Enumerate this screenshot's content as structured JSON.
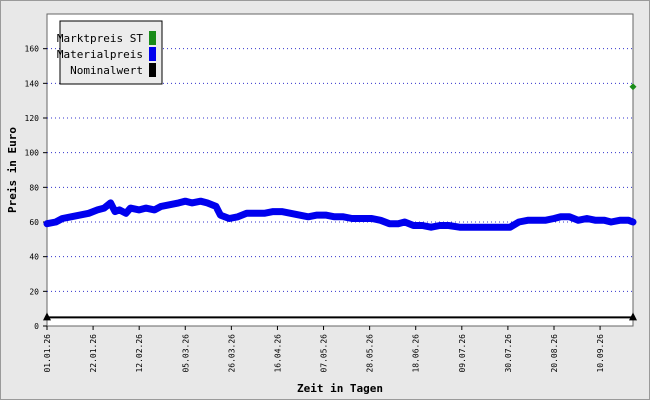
{
  "chart_data": {
    "type": "line",
    "xlabel": "Zeit in Tagen",
    "ylabel": "Preis in Euro",
    "ylim": [
      0,
      180
    ],
    "yticks": [
      0,
      20,
      40,
      60,
      80,
      100,
      120,
      140,
      160
    ],
    "xlim": [
      "2026-01-01",
      "2026-09-25"
    ],
    "xticks": [
      "01.01.26",
      "22.01.26",
      "12.02.26",
      "05.03.26",
      "26.03.26",
      "16.04.26",
      "07.05.26",
      "28.05.26",
      "18.06.26",
      "09.07.26",
      "30.07.26",
      "20.08.26",
      "10.09.26"
    ],
    "grid": "horizontal dotted",
    "legend_position": "top-left",
    "legend": [
      {
        "label": "Marktpreis ST",
        "color": "#1a8c1a"
      },
      {
        "label": "Materialpreis",
        "color": "#0000ee"
      },
      {
        "label": "Nominalwert",
        "color": "#000000"
      }
    ],
    "series": [
      {
        "name": "Materialpreis",
        "color": "#0000ee",
        "points": [
          [
            "2026-01-01",
            59
          ],
          [
            "2026-01-05",
            60
          ],
          [
            "2026-01-08",
            62
          ],
          [
            "2026-01-12",
            63
          ],
          [
            "2026-01-16",
            64
          ],
          [
            "2026-01-20",
            65
          ],
          [
            "2026-01-24",
            67
          ],
          [
            "2026-01-27",
            68
          ],
          [
            "2026-01-30",
            71
          ],
          [
            "2026-02-01",
            66
          ],
          [
            "2026-02-03",
            67
          ],
          [
            "2026-02-06",
            65
          ],
          [
            "2026-02-08",
            68
          ],
          [
            "2026-02-12",
            67
          ],
          [
            "2026-02-15",
            68
          ],
          [
            "2026-02-19",
            67
          ],
          [
            "2026-02-22",
            69
          ],
          [
            "2026-02-26",
            70
          ],
          [
            "2026-03-02",
            71
          ],
          [
            "2026-03-05",
            72
          ],
          [
            "2026-03-08",
            71
          ],
          [
            "2026-03-12",
            72
          ],
          [
            "2026-03-15",
            71
          ],
          [
            "2026-03-19",
            69
          ],
          [
            "2026-03-21",
            64
          ],
          [
            "2026-03-25",
            62
          ],
          [
            "2026-03-29",
            63
          ],
          [
            "2026-04-02",
            65
          ],
          [
            "2026-04-06",
            65
          ],
          [
            "2026-04-10",
            65
          ],
          [
            "2026-04-14",
            66
          ],
          [
            "2026-04-18",
            66
          ],
          [
            "2026-04-22",
            65
          ],
          [
            "2026-04-26",
            64
          ],
          [
            "2026-04-30",
            63
          ],
          [
            "2026-05-04",
            64
          ],
          [
            "2026-05-08",
            64
          ],
          [
            "2026-05-12",
            63
          ],
          [
            "2026-05-16",
            63
          ],
          [
            "2026-05-20",
            62
          ],
          [
            "2026-05-25",
            62
          ],
          [
            "2026-05-29",
            62
          ],
          [
            "2026-06-02",
            61
          ],
          [
            "2026-06-06",
            59
          ],
          [
            "2026-06-10",
            59
          ],
          [
            "2026-06-13",
            60
          ],
          [
            "2026-06-17",
            58
          ],
          [
            "2026-06-21",
            58
          ],
          [
            "2026-06-25",
            57
          ],
          [
            "2026-06-29",
            58
          ],
          [
            "2026-07-03",
            58
          ],
          [
            "2026-07-08",
            57
          ],
          [
            "2026-07-12",
            57
          ],
          [
            "2026-07-16",
            57
          ],
          [
            "2026-07-20",
            57
          ],
          [
            "2026-07-24",
            57
          ],
          [
            "2026-07-28",
            57
          ],
          [
            "2026-07-31",
            57
          ],
          [
            "2026-08-04",
            60
          ],
          [
            "2026-08-08",
            61
          ],
          [
            "2026-08-12",
            61
          ],
          [
            "2026-08-16",
            61
          ],
          [
            "2026-08-20",
            62
          ],
          [
            "2026-08-23",
            63
          ],
          [
            "2026-08-27",
            63
          ],
          [
            "2026-08-31",
            61
          ],
          [
            "2026-09-04",
            62
          ],
          [
            "2026-09-08",
            61
          ],
          [
            "2026-09-12",
            61
          ],
          [
            "2026-09-15",
            60
          ],
          [
            "2026-09-19",
            61
          ],
          [
            "2026-09-23",
            61
          ],
          [
            "2026-09-25",
            60
          ]
        ]
      },
      {
        "name": "Marktpreis ST",
        "color": "#1a8c1a",
        "points": [
          [
            "2026-09-25",
            138
          ]
        ]
      },
      {
        "name": "Nominalwert",
        "color": "#000000",
        "points": [
          [
            "2026-01-01",
            5
          ],
          [
            "2026-09-25",
            5
          ]
        ]
      }
    ]
  }
}
